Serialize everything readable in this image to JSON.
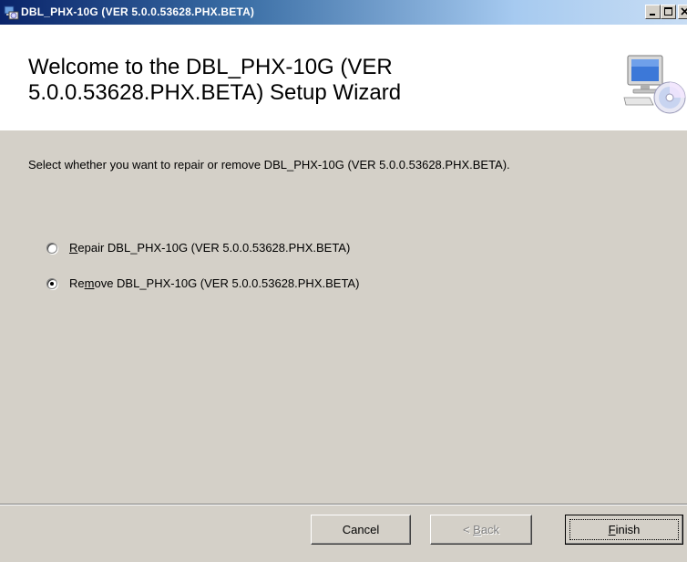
{
  "window": {
    "title": "DBL_PHX-10G (VER 5.0.0.53628.PHX.BETA)",
    "controls": {
      "minimize": "_",
      "maximize": "□",
      "close": "×"
    }
  },
  "banner": {
    "title": "Welcome to the DBL_PHX-10G (VER 5.0.0.53628.PHX.BETA) Setup Wizard",
    "icon": "computer-with-cd-icon"
  },
  "instruction": "Select whether you want to repair or remove DBL_PHX-10G (VER 5.0.0.53628.PHX.BETA).",
  "options": [
    {
      "mnemonic": "R",
      "label_rest": "epair DBL_PHX-10G (VER 5.0.0.53628.PHX.BETA)",
      "selected": false
    },
    {
      "label_pre": "Re",
      "mnemonic": "m",
      "label_rest": "ove DBL_PHX-10G (VER 5.0.0.53628.PHX.BETA)",
      "selected": true
    }
  ],
  "buttons": {
    "cancel": "Cancel",
    "back_pre": "< ",
    "back_mnemonic": "B",
    "back_rest": "ack",
    "finish_mnemonic": "F",
    "finish_rest": "inish"
  }
}
